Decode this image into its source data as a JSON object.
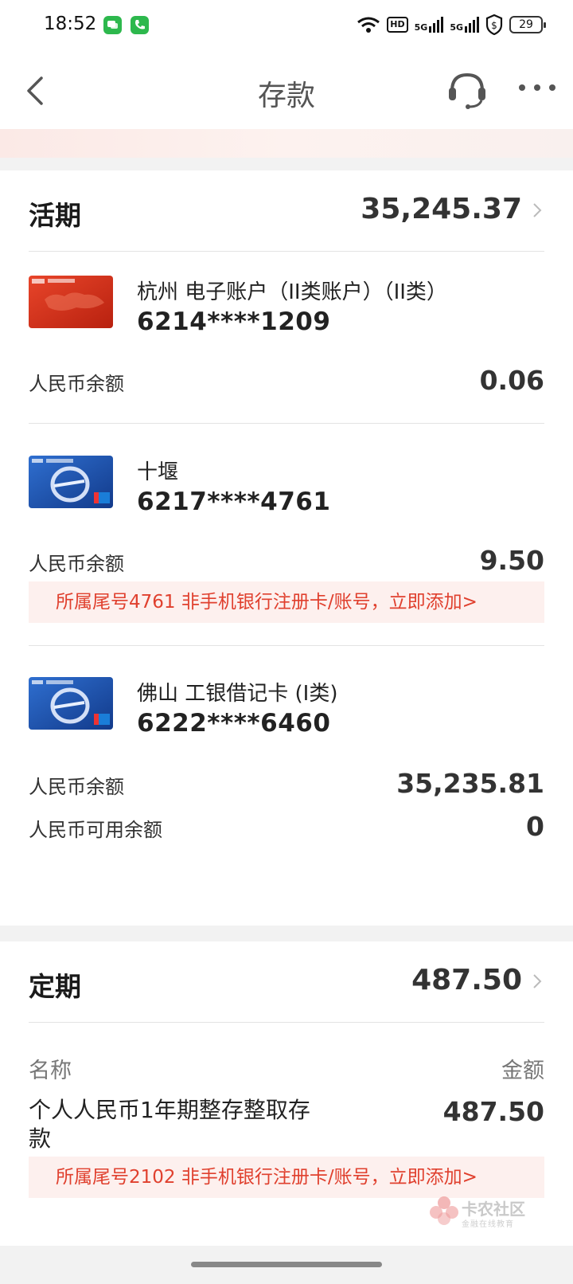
{
  "status_bar": {
    "time": "18:52",
    "battery": "29",
    "hd_label": "HD",
    "net1": "5G",
    "net2": "5G"
  },
  "nav": {
    "title": "存款"
  },
  "current": {
    "title": "活期",
    "total": "35,245.37",
    "accounts": [
      {
        "name": "杭州 电子账户（II类账户）（II类）",
        "number": "6214****1209",
        "balance_label": "人民币余额",
        "balance": "0.06",
        "card_style": "red"
      },
      {
        "name": "十堰",
        "number": "6217****4761",
        "balance_label": "人民币余额",
        "balance": "9.50",
        "card_style": "blue",
        "notice": "所属尾号4761 非手机银行注册卡/账号，立即添加>"
      },
      {
        "name": "佛山 工银借记卡 (I类)",
        "number": "6222****6460",
        "balance_label": "人民币余额",
        "balance": "35,235.81",
        "available_label": "人民币可用余额",
        "available": "0",
        "card_style": "blue"
      }
    ]
  },
  "fixed": {
    "title": "定期",
    "total": "487.50",
    "col_name": "名称",
    "col_amount": "金额",
    "item": {
      "name": "个人人民币1年期整存整取存款",
      "amount": "487.50",
      "notice": "所属尾号2102 非手机银行注册卡/账号，立即添加>"
    }
  },
  "watermark": {
    "title": "卡农社区",
    "subtitle": "金融在线教育"
  },
  "colors": {
    "accent_red": "#e0402e",
    "notice_bg": "#fdf0ee"
  }
}
